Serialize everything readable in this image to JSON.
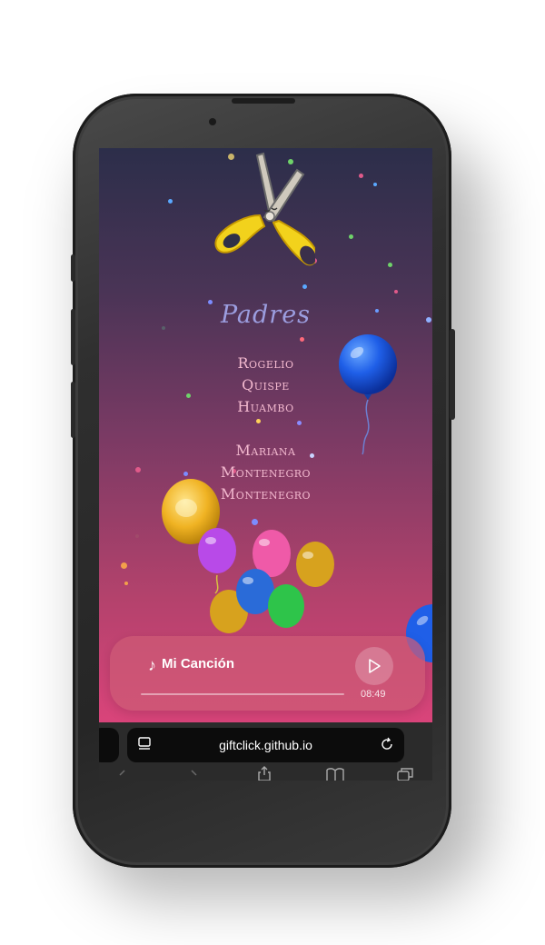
{
  "invitation": {
    "heading": "Padres",
    "parent1": [
      "Rogelio",
      "Quispe",
      "Huambo"
    ],
    "parent2": [
      "Mariana",
      "Montenegro",
      "Montenegro"
    ]
  },
  "player": {
    "song_title": "Mi Canción",
    "time": "08:49",
    "progress": 0
  },
  "browser": {
    "url": "giftclick.github.io"
  },
  "icons": {
    "scissors": "scissors-icon",
    "music": "music-note-icon",
    "play": "play-icon",
    "tabs": "tab-overview-icon",
    "reload": "reload-icon",
    "back": "back-chevron-icon",
    "forward": "forward-chevron-icon",
    "share": "share-icon",
    "bookmarks": "bookmarks-icon",
    "tab_switcher": "tabs-icon"
  },
  "colors": {
    "heading": "#9c9ee0",
    "names": "#f3b9cf",
    "gradient_top": "#2c2e4a",
    "gradient_bottom": "#d9447a"
  }
}
